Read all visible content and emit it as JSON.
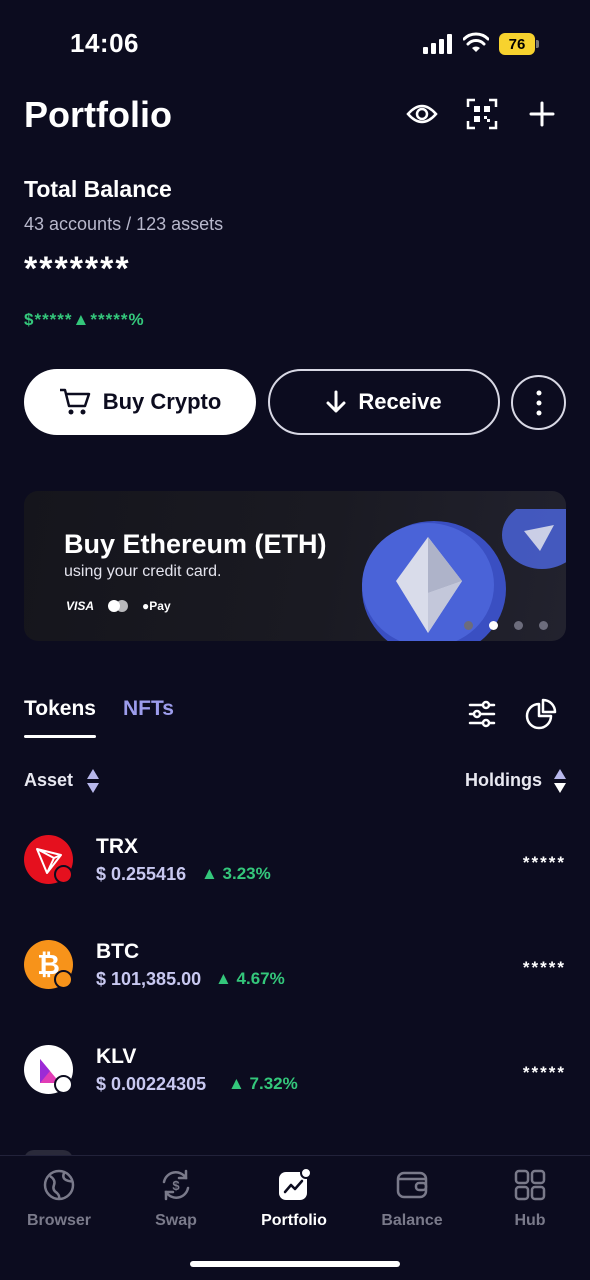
{
  "status_bar": {
    "time": "14:06",
    "battery": "76",
    "battery_color": "#f7d22e"
  },
  "header": {
    "title": "Portfolio"
  },
  "balance": {
    "title": "Total Balance",
    "subtitle": "43 accounts / 123 assets",
    "amount": "*******",
    "change": "$*****▲*****%"
  },
  "actions": {
    "buy_label": "Buy Crypto",
    "receive_label": "Receive"
  },
  "banner": {
    "title": "Buy Ethereum (ETH)",
    "subtitle": "using your credit card.",
    "payment_methods": [
      "VISA",
      "Mastercard",
      "Pay"
    ],
    "active_slide": 2,
    "slide_count": 4
  },
  "tabs": {
    "tokens": "Tokens",
    "nfts": "NFTs"
  },
  "sort": {
    "asset": "Asset",
    "holdings": "Holdings"
  },
  "tokens": [
    {
      "symbol": "TRX",
      "price": "$ 0.255416",
      "change": "▲ 3.23%",
      "holdings": "*****",
      "color": "#e5101e"
    },
    {
      "symbol": "BTC",
      "price": "$ 101,385.00",
      "change": "▲ 4.67%",
      "holdings": "*****",
      "color": "#f7931a"
    },
    {
      "symbol": "KLV",
      "price": "$ 0.00224305",
      "change": "▲ 7.32%",
      "holdings": "*****",
      "color": "#ffffff"
    }
  ],
  "nav": [
    {
      "label": "Browser",
      "icon": "globe-icon"
    },
    {
      "label": "Swap",
      "icon": "swap-icon"
    },
    {
      "label": "Portfolio",
      "icon": "chart-icon"
    },
    {
      "label": "Balance",
      "icon": "wallet-icon"
    },
    {
      "label": "Hub",
      "icon": "grid-icon"
    }
  ],
  "colors": {
    "background": "#0c0c1f",
    "positive": "#34c77b",
    "accent": "#9d9dec"
  }
}
